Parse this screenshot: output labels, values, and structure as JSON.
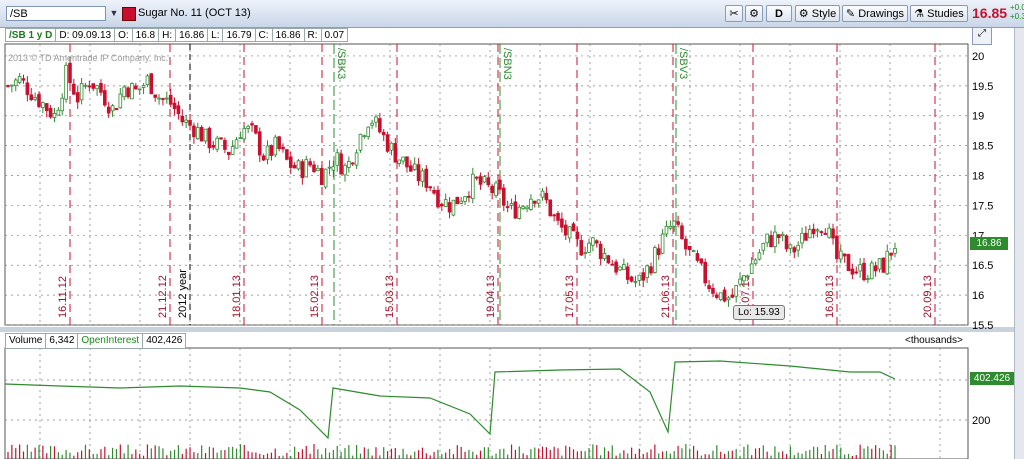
{
  "toolbar": {
    "symbol": "/SB",
    "description": "Sugar No. 11 (OCT 13)",
    "d_label": "D",
    "style_label": "Style",
    "drawings_label": "Drawings",
    "studies_label": "Studies",
    "last_price": "16.85",
    "change_1": "+0.0",
    "change_2": "+0.3"
  },
  "info": {
    "symbol_period": "/SB 1 y D",
    "date": "D: 09.09.13",
    "open_label": "O:",
    "open": "16.8",
    "high_label": "H:",
    "high": "16.86",
    "low_label": "L:",
    "low": "16.79",
    "close_label": "C:",
    "close": "16.86",
    "range_label": "R:",
    "range": "0.07"
  },
  "copyright": "2013 © TD Ameritrade IP Company, Inc.",
  "lo_label": "Lo: 15.93",
  "current_price_tag": "16.86",
  "lower": {
    "volume_label": "Volume",
    "volume": "6,342",
    "oi_label": "OpenInterest",
    "oi": "402,426",
    "units": "<thousands>",
    "oi_tag": "402.426",
    "tick_200": "200"
  },
  "colors": {
    "up": "#2e8b2e",
    "down": "#c8102e",
    "grid": "#808080",
    "oi_line": "#2e8b2e",
    "price_up_tag": "#2e8b2e"
  },
  "chart_data": {
    "type": "candlestick",
    "yticks": [
      "20",
      "19.5",
      "19",
      "18.5",
      "18",
      "17.5",
      "17",
      "16.5",
      "16",
      "15.5"
    ],
    "ylim": [
      15.5,
      20.2
    ],
    "date_markers": [
      "16.11.12",
      "21.12.12",
      "18.01.13",
      "15.02.13",
      "15.03.13",
      "19.04.13",
      "17.05.13",
      "21.06.13",
      "19.07.13",
      "16.08.13",
      "20.09.13"
    ],
    "year_marker": "2012 year",
    "contract_rolls": [
      "/SBK3",
      "/SBN3",
      "/SBV3"
    ],
    "close_series": [
      19.5,
      19.6,
      19.4,
      19.2,
      19.0,
      19.7,
      19.3,
      19.6,
      19.4,
      19.1,
      19.5,
      19.4,
      19.6,
      19.3,
      19.2,
      18.9,
      18.8,
      18.6,
      18.5,
      18.4,
      18.8,
      18.7,
      18.3,
      18.5,
      18.2,
      18.1,
      18.2,
      18.0,
      18.3,
      18.1,
      18.6,
      19.0,
      18.7,
      18.4,
      18.2,
      18.0,
      17.9,
      17.6,
      17.5,
      17.7,
      17.9,
      17.8,
      17.7,
      17.4,
      17.5,
      17.7,
      17.6,
      17.2,
      17.0,
      16.8,
      16.9,
      16.7,
      16.5,
      16.3,
      16.2,
      16.5,
      16.9,
      17.2,
      16.8,
      16.5,
      16.2,
      16.0,
      15.95,
      16.3,
      16.6,
      16.9,
      17.0,
      16.7,
      16.9,
      17.2,
      17.2,
      16.6,
      16.5,
      16.4,
      16.4,
      16.5,
      16.86
    ]
  }
}
